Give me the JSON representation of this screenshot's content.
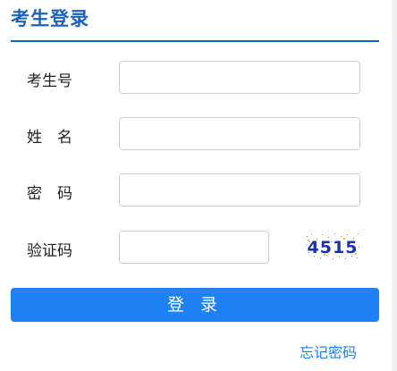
{
  "header": {
    "title": "考生登录"
  },
  "form": {
    "fields": [
      {
        "label": "考生号"
      },
      {
        "label": "姓　名"
      },
      {
        "label": "密　码"
      },
      {
        "label": "验证码"
      }
    ],
    "captcha": {
      "code": "4515"
    }
  },
  "actions": {
    "login_label": "登 录",
    "forgot_password": "忘记密码"
  },
  "colors": {
    "primary": "#1e82f5",
    "header": "#1f63b8"
  }
}
